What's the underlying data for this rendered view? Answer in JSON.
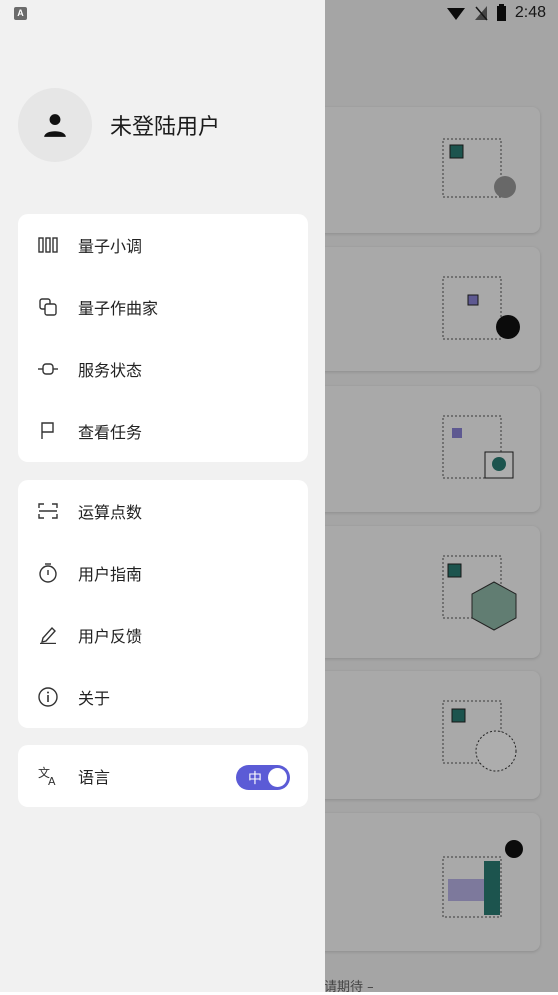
{
  "status_bar": {
    "notification_badge": "A",
    "time": "2:48"
  },
  "user": {
    "name": "未登陆用户"
  },
  "menu_group_1": {
    "items": [
      {
        "label": "量子小调",
        "icon": "bars-icon"
      },
      {
        "label": "量子作曲家",
        "icon": "copy-icon"
      },
      {
        "label": "服务状态",
        "icon": "node-icon"
      },
      {
        "label": "查看任务",
        "icon": "flag-icon"
      }
    ]
  },
  "menu_group_2": {
    "items": [
      {
        "label": "运算点数",
        "icon": "scan-icon"
      },
      {
        "label": "用户指南",
        "icon": "timer-icon"
      },
      {
        "label": "用户反馈",
        "icon": "pen-icon"
      },
      {
        "label": "关于",
        "icon": "info-icon"
      }
    ]
  },
  "language": {
    "label": "语言",
    "toggle_text": "中",
    "toggle_color": "#5b5bd6"
  },
  "background": {
    "footer_text": "请期待 –"
  }
}
